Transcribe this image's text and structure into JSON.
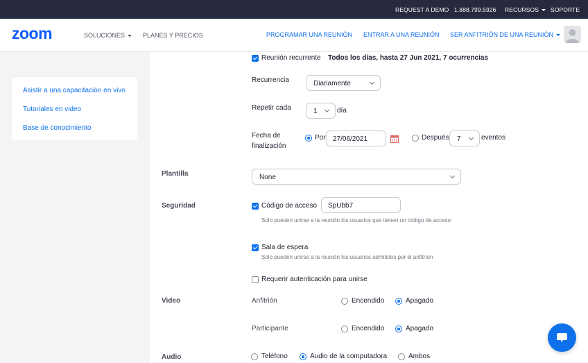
{
  "topbar": {
    "request_demo": "REQUEST A DEMO",
    "phone": "1.888.799.5926",
    "recursos": "RECURSOS",
    "soporte": "SOPORTE"
  },
  "navbar": {
    "logo_text": "zoom",
    "soluciones": "SOLUCIONES",
    "planes": "PLANES Y PRECIOS",
    "programar": "PROGRAMAR UNA REUNIÓN",
    "entrar": "ENTRAR A UNA REUNIÓN",
    "anfitrion": "SER ANFITRIÓN DE UNA REUNIÓN"
  },
  "sidebar": {
    "items": [
      {
        "label": "Asistir a una capacitación en vivo"
      },
      {
        "label": "Tutoriales en video"
      },
      {
        "label": "Base de conocimiento"
      }
    ]
  },
  "form": {
    "recurrent": {
      "label": "Reunión recurrente",
      "summary": "Todos los días, hasta 27 Jun 2021, 7 ocurrencias",
      "checked": true
    },
    "recurrencia": {
      "label": "Recurrencia",
      "value": "Diariamente"
    },
    "repetir": {
      "label": "Repetir cada",
      "value": "1",
      "unit": "día"
    },
    "fin": {
      "label_line1": "Fecha de",
      "label_line2": "finalización",
      "por_label": "Por",
      "date": "27/06/2021",
      "despues_label": "Después",
      "count": "7",
      "eventos": "eventos",
      "selected": "Por"
    },
    "plantilla": {
      "label": "Plantilla",
      "value": "None"
    },
    "seguridad": {
      "label": "Seguridad",
      "passcode": {
        "label": "Código de acceso",
        "value": "SpUbb7",
        "hint": "Solo pueden unirse a la reunión los usuarios que tienen un código de acceso",
        "checked": true
      },
      "waiting": {
        "label": "Sala de espera",
        "hint": "Solo pueden unirse a la reunión los usuarios admitidos por el anfitrión",
        "checked": true
      },
      "auth": {
        "label": "Requerir autenticación para unirse",
        "checked": false
      }
    },
    "video": {
      "label": "Video",
      "host": {
        "label": "Anfitrión",
        "on": "Encendido",
        "off": "Apagado",
        "selected": "Apagado"
      },
      "participant": {
        "label": "Participante",
        "on": "Encendido",
        "off": "Apagado",
        "selected": "Apagado"
      }
    },
    "audio": {
      "label": "Audio",
      "options": [
        "Teléfono",
        "Audio de la computadora",
        "Ambos"
      ],
      "selected": "Audio de la computadora"
    }
  },
  "colors": {
    "accent": "#0e71eb",
    "topbar": "#272a3f",
    "page_bg": "#f4f4f6"
  },
  "icons": {
    "calendar": "calendar-icon",
    "chat": "chat-icon",
    "avatar": "user-avatar-icon"
  }
}
